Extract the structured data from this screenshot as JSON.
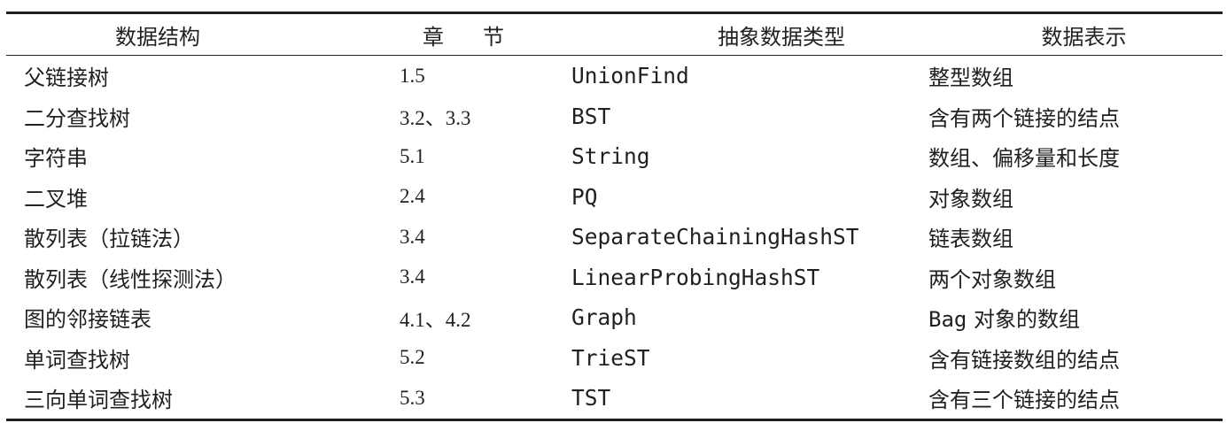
{
  "headers": {
    "structure": "数据结构",
    "section_a": "章",
    "section_b": "节",
    "adt": "抽象数据类型",
    "representation": "数据表示"
  },
  "rows": [
    {
      "structure": "父链接树",
      "section": "1.5",
      "adt": "UnionFind",
      "repr": "整型数组"
    },
    {
      "structure": "二分查找树",
      "section": "3.2、3.3",
      "adt": "BST",
      "repr": "含有两个链接的结点"
    },
    {
      "structure": "字符串",
      "section": "5.1",
      "adt": "String",
      "repr": "数组、偏移量和长度"
    },
    {
      "structure": "二叉堆",
      "section": "2.4",
      "adt": "PQ",
      "repr": "对象数组"
    },
    {
      "structure": "散列表（拉链法）",
      "section": "3.4",
      "adt": "SeparateChainingHashST",
      "repr": "链表数组"
    },
    {
      "structure": "散列表（线性探测法）",
      "section": "3.4",
      "adt": "LinearProbingHashST",
      "repr": "两个对象数组"
    },
    {
      "structure": "图的邻接链表",
      "section": "4.1、4.2",
      "adt": "Graph",
      "repr_code": "Bag",
      "repr": " 对象的数组"
    },
    {
      "structure": "单词查找树",
      "section": "5.2",
      "adt": "TrieST",
      "repr": "含有链接数组的结点"
    },
    {
      "structure": "三向单词查找树",
      "section": "5.3",
      "adt": "TST",
      "repr": "含有三个链接的结点"
    }
  ]
}
